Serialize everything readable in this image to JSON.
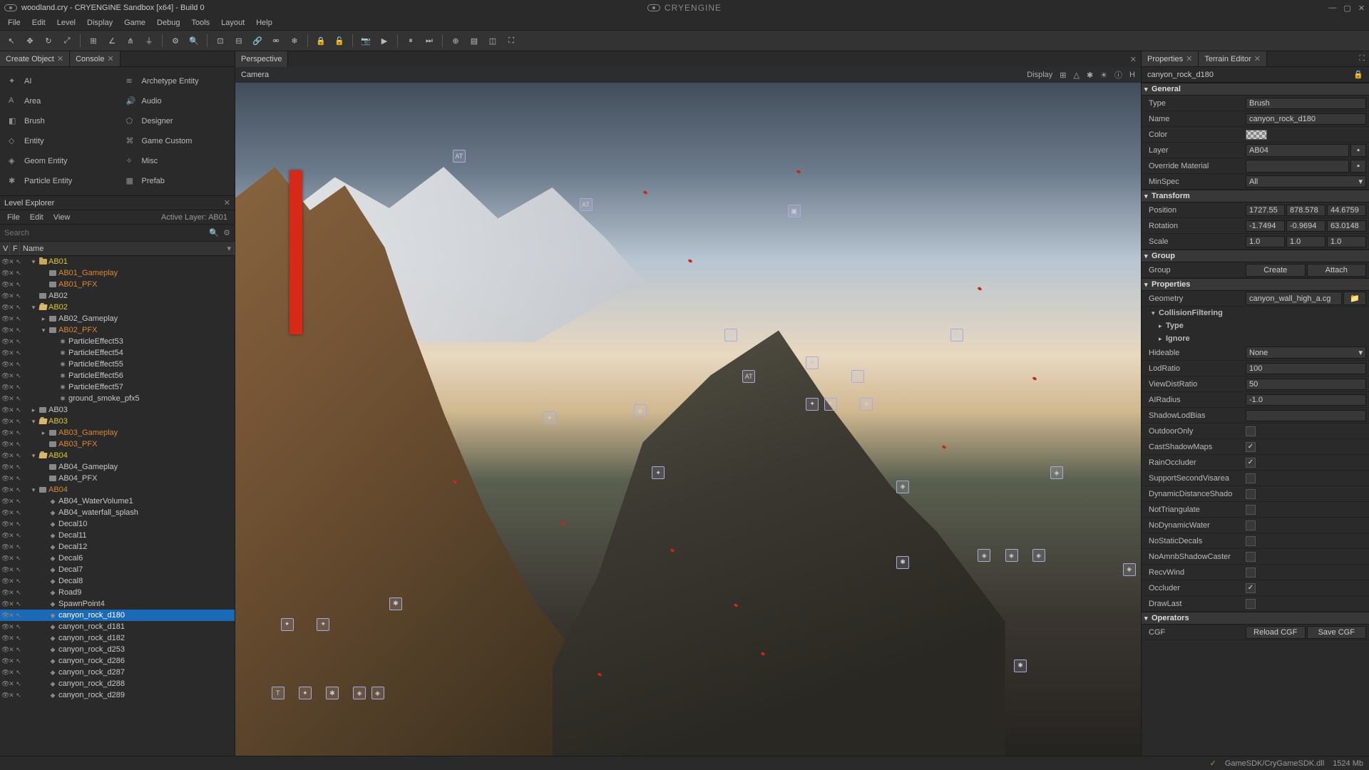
{
  "title": "woodland.cry - CRYENGINE Sandbox [x64] - Build 0",
  "brand": "CRYENGINE",
  "menu": [
    "File",
    "Edit",
    "Level",
    "Display",
    "Game",
    "Debug",
    "Tools",
    "Layout",
    "Help"
  ],
  "left_tabs": [
    "Create Object",
    "Console"
  ],
  "create_items": [
    {
      "label": "AI",
      "icon": "✦"
    },
    {
      "label": "Archetype Entity",
      "icon": "≋"
    },
    {
      "label": "Area",
      "icon": "A"
    },
    {
      "label": "Audio",
      "icon": "🔊"
    },
    {
      "label": "Brush",
      "icon": "◧"
    },
    {
      "label": "Designer",
      "icon": "⬠"
    },
    {
      "label": "Entity",
      "icon": "◇"
    },
    {
      "label": "Game Custom",
      "icon": "⌘"
    },
    {
      "label": "Geom Entity",
      "icon": "◈"
    },
    {
      "label": "Misc",
      "icon": "✧"
    },
    {
      "label": "Particle Entity",
      "icon": "✱"
    },
    {
      "label": "Prefab",
      "icon": "▦"
    }
  ],
  "level_explorer": {
    "title": "Level Explorer",
    "menu": [
      "File",
      "Edit",
      "View"
    ],
    "active_layer": "Active Layer: AB01",
    "search_placeholder": "Search",
    "cols": [
      "V",
      "F",
      "Name"
    ]
  },
  "tree": [
    {
      "d": 0,
      "c": "▾",
      "t": "folder",
      "l": "AB01",
      "cls": "yellow"
    },
    {
      "d": 1,
      "c": "",
      "t": "layer",
      "l": "AB01_Gameplay",
      "cls": "orange"
    },
    {
      "d": 1,
      "c": "",
      "t": "layer",
      "l": "AB01_PFX",
      "cls": "orange"
    },
    {
      "d": 0,
      "c": "",
      "t": "layer",
      "l": "AB02"
    },
    {
      "d": 0,
      "c": "▾",
      "t": "folder-open",
      "l": "AB02",
      "cls": "yellow"
    },
    {
      "d": 1,
      "c": "▸",
      "t": "layer",
      "l": "AB02_Gameplay"
    },
    {
      "d": 1,
      "c": "▾",
      "t": "layer",
      "l": "AB02_PFX",
      "cls": "orange"
    },
    {
      "d": 2,
      "c": "",
      "t": "pfx",
      "l": "ParticleEffect53"
    },
    {
      "d": 2,
      "c": "",
      "t": "pfx",
      "l": "ParticleEffect54"
    },
    {
      "d": 2,
      "c": "",
      "t": "pfx",
      "l": "ParticleEffect55"
    },
    {
      "d": 2,
      "c": "",
      "t": "pfx",
      "l": "ParticleEffect56"
    },
    {
      "d": 2,
      "c": "",
      "t": "pfx",
      "l": "ParticleEffect57"
    },
    {
      "d": 2,
      "c": "",
      "t": "pfx",
      "l": "ground_smoke_pfx5"
    },
    {
      "d": 0,
      "c": "▸",
      "t": "layer",
      "l": "AB03"
    },
    {
      "d": 0,
      "c": "▾",
      "t": "folder-open",
      "l": "AB03",
      "cls": "yellow"
    },
    {
      "d": 1,
      "c": "▸",
      "t": "layer",
      "l": "AB03_Gameplay",
      "cls": "orange"
    },
    {
      "d": 1,
      "c": "",
      "t": "layer",
      "l": "AB03_PFX",
      "cls": "orange"
    },
    {
      "d": 0,
      "c": "▾",
      "t": "folder-open",
      "l": "AB04",
      "cls": "yellow"
    },
    {
      "d": 1,
      "c": "",
      "t": "layer",
      "l": "AB04_Gameplay"
    },
    {
      "d": 1,
      "c": "",
      "t": "layer",
      "l": "AB04_PFX"
    },
    {
      "d": 0,
      "c": "▾",
      "t": "layer",
      "l": "AB04",
      "cls": "orange"
    },
    {
      "d": 1,
      "c": "",
      "t": "obj",
      "l": "AB04_WaterVolume1"
    },
    {
      "d": 1,
      "c": "",
      "t": "obj",
      "l": "AB04_waterfall_splash"
    },
    {
      "d": 1,
      "c": "",
      "t": "obj",
      "l": "Decal10"
    },
    {
      "d": 1,
      "c": "",
      "t": "obj",
      "l": "Decal11"
    },
    {
      "d": 1,
      "c": "",
      "t": "obj",
      "l": "Decal12"
    },
    {
      "d": 1,
      "c": "",
      "t": "obj",
      "l": "Decal6"
    },
    {
      "d": 1,
      "c": "",
      "t": "obj",
      "l": "Decal7"
    },
    {
      "d": 1,
      "c": "",
      "t": "obj",
      "l": "Decal8"
    },
    {
      "d": 1,
      "c": "",
      "t": "obj",
      "l": "Road9"
    },
    {
      "d": 1,
      "c": "",
      "t": "obj",
      "l": "SpawnPoint4"
    },
    {
      "d": 1,
      "c": "",
      "t": "obj",
      "l": "canyon_rock_d180",
      "sel": true
    },
    {
      "d": 1,
      "c": "",
      "t": "obj",
      "l": "canyon_rock_d181"
    },
    {
      "d": 1,
      "c": "",
      "t": "obj",
      "l": "canyon_rock_d182"
    },
    {
      "d": 1,
      "c": "",
      "t": "obj",
      "l": "canyon_rock_d253"
    },
    {
      "d": 1,
      "c": "",
      "t": "obj",
      "l": "canyon_rock_d286"
    },
    {
      "d": 1,
      "c": "",
      "t": "obj",
      "l": "canyon_rock_d287"
    },
    {
      "d": 1,
      "c": "",
      "t": "obj",
      "l": "canyon_rock_d288"
    },
    {
      "d": 1,
      "c": "",
      "t": "obj",
      "l": "canyon_rock_d289"
    }
  ],
  "viewport": {
    "tab": "Perspective",
    "camera_label": "Camera",
    "display_label": "Display"
  },
  "right_tabs": [
    "Properties",
    "Terrain Editor"
  ],
  "selected": "canyon_rock_d180",
  "sections": {
    "general": "General",
    "transform": "Transform",
    "group": "Group",
    "properties": "Properties",
    "collision": "CollisionFiltering",
    "operators": "Operators"
  },
  "general": {
    "type": {
      "label": "Type",
      "value": "Brush"
    },
    "name": {
      "label": "Name",
      "value": "canyon_rock_d180"
    },
    "color": {
      "label": "Color"
    },
    "layer": {
      "label": "Layer",
      "value": "AB04"
    },
    "override": {
      "label": "Override Material",
      "value": ""
    },
    "minspec": {
      "label": "MinSpec",
      "value": "All"
    }
  },
  "transform": {
    "position": {
      "label": "Position",
      "x": "1727.55",
      "y": "878.578",
      "z": "44.6759"
    },
    "rotation": {
      "label": "Rotation",
      "x": "-1.7494",
      "y": "-0.9694",
      "z": "63.0148"
    },
    "scale": {
      "label": "Scale",
      "x": "1.0",
      "y": "1.0",
      "z": "1.0"
    }
  },
  "group_btns": {
    "label": "Group",
    "create": "Create",
    "attach": "Attach"
  },
  "properties": {
    "geometry": {
      "label": "Geometry",
      "value": "canyon_wall_high_a.cg"
    },
    "type_sub": "Type",
    "ignore_sub": "Ignore",
    "hideable": {
      "label": "Hideable",
      "value": "None"
    },
    "lodratio": {
      "label": "LodRatio",
      "value": "100"
    },
    "viewdist": {
      "label": "ViewDistRatio",
      "value": "50"
    },
    "airadius": {
      "label": "AIRadius",
      "value": "-1.0"
    },
    "shadowlod": {
      "label": "ShadowLodBias",
      "value": ""
    },
    "outdooronly": {
      "label": "OutdoorOnly",
      "checked": false
    },
    "castshadow": {
      "label": "CastShadowMaps",
      "checked": true
    },
    "rainoccluder": {
      "label": "RainOccluder",
      "checked": true
    },
    "supportsecond": {
      "label": "SupportSecondVisarea",
      "checked": false
    },
    "dynamicdistance": {
      "label": "DynamicDistanceShado",
      "checked": false
    },
    "nottriangulate": {
      "label": "NotTriangulate",
      "checked": false
    },
    "nodynamicwater": {
      "label": "NoDynamicWater",
      "checked": false
    },
    "nostaticdecals": {
      "label": "NoStaticDecals",
      "checked": false
    },
    "noamnb": {
      "label": "NoAmnbShadowCaster",
      "checked": false
    },
    "recvwind": {
      "label": "RecvWind",
      "checked": false
    },
    "occluder": {
      "label": "Occluder",
      "checked": true
    },
    "drawlast": {
      "label": "DrawLast",
      "checked": false
    }
  },
  "operators": {
    "cgf": "CGF",
    "reload": "Reload CGF",
    "save": "Save CGF"
  },
  "status": {
    "dll": "GameSDK/CryGameSDK.dll",
    "mem": "1524 Mb"
  }
}
